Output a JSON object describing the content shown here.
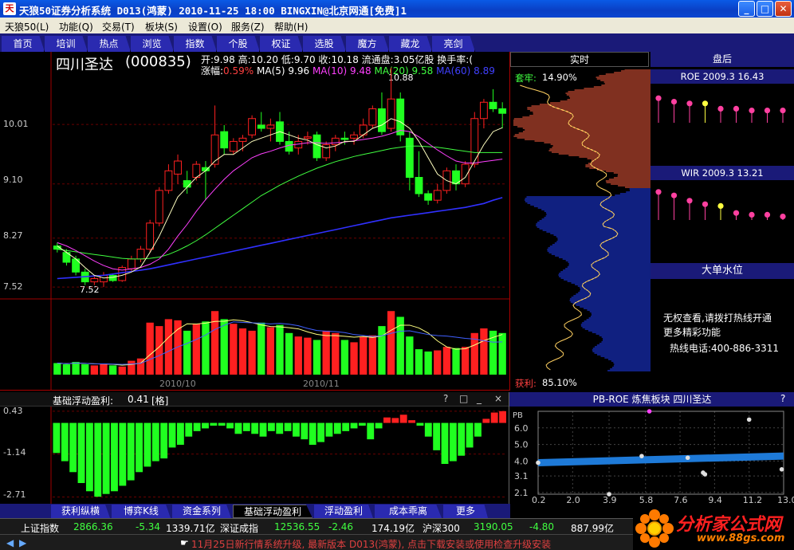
{
  "window": {
    "title": "天狼50证券分析系统 D013(鸿蒙) 2010-11-25 18:00 BINGXIN@北京网通[免费]1",
    "icon": "tianlang-logo-icon"
  },
  "menu": [
    {
      "label": "天狼50(L)"
    },
    {
      "label": "功能(Q)"
    },
    {
      "label": "交易(T)"
    },
    {
      "label": "板块(S)"
    },
    {
      "label": "设置(O)"
    },
    {
      "label": "服务(Z)"
    },
    {
      "label": "帮助(H)"
    }
  ],
  "toolbar": [
    "首页",
    "培训",
    "热点",
    "浏览",
    "指数",
    "个股",
    "权证",
    "选股",
    "魔方",
    "藏龙",
    "亮剑"
  ],
  "stock": {
    "name": "四川圣达",
    "code": "(000835)",
    "open_label": "开:",
    "open": "9.98",
    "high_label": "高:",
    "high": "10.20",
    "low_label": "低:",
    "low": "9.70",
    "close_label": "收:",
    "close": "10.18",
    "float_label": "流通盘:",
    "float": "3.05亿股",
    "turnover_label": "换手率:",
    "turnover": "(",
    "change_label": "涨幅:",
    "change": "0.59%"
  },
  "ma": [
    {
      "label": "MA(5)",
      "value": "9.96",
      "color": "#ffffff"
    },
    {
      "label": "MA(10)",
      "value": "9.48",
      "color": "#ff40ff"
    },
    {
      "label": "MA(20)",
      "value": "9.58",
      "color": "#40ff40"
    },
    {
      "label": "MA(60)",
      "value": "8.89",
      "color": "#4040ff"
    }
  ],
  "price_axis": [
    "10.01",
    "9.10",
    "8.27",
    "7.52"
  ],
  "markers": {
    "high": "10.88",
    "low": "7.52"
  },
  "months": [
    "2010/10",
    "2010/11"
  ],
  "chart_data": [
    {
      "type": "candlestick",
      "title": "四川圣达(000835)",
      "candles": [
        [
          8.15,
          8.2,
          8.05,
          8.1
        ],
        [
          8.05,
          8.1,
          7.85,
          7.9
        ],
        [
          7.95,
          8.0,
          7.7,
          7.75
        ],
        [
          7.75,
          7.8,
          7.55,
          7.6
        ],
        [
          7.6,
          7.7,
          7.55,
          7.65
        ],
        [
          7.6,
          7.75,
          7.52,
          7.7
        ],
        [
          7.7,
          7.72,
          7.6,
          7.62
        ],
        [
          7.62,
          7.85,
          7.6,
          7.82
        ],
        [
          7.8,
          8.0,
          7.75,
          7.95
        ],
        [
          7.95,
          8.15,
          7.9,
          8.1
        ],
        [
          8.1,
          8.55,
          8.05,
          8.5
        ],
        [
          8.5,
          9.05,
          8.45,
          9.0
        ],
        [
          9.0,
          9.4,
          8.95,
          9.3
        ],
        [
          9.25,
          9.55,
          9.1,
          9.45
        ],
        [
          9.15,
          9.3,
          8.95,
          9.05
        ],
        [
          9.2,
          9.45,
          9.15,
          9.4
        ],
        [
          9.35,
          9.45,
          8.85,
          9.3
        ],
        [
          9.4,
          10.3,
          9.35,
          9.85
        ],
        [
          9.9,
          10.0,
          9.55,
          9.65
        ],
        [
          9.6,
          9.8,
          9.55,
          9.75
        ],
        [
          9.75,
          9.85,
          9.6,
          9.8
        ],
        [
          9.85,
          10.15,
          9.8,
          10.1
        ],
        [
          10.0,
          10.2,
          9.9,
          9.95
        ],
        [
          9.95,
          10.1,
          9.75,
          10.0
        ],
        [
          10.05,
          10.2,
          9.7,
          9.75
        ],
        [
          9.75,
          9.9,
          9.55,
          9.6
        ],
        [
          9.65,
          9.85,
          9.55,
          9.75
        ],
        [
          9.8,
          9.9,
          9.7,
          9.82
        ],
        [
          9.85,
          9.9,
          9.45,
          9.5
        ],
        [
          9.5,
          9.75,
          9.45,
          9.7
        ],
        [
          9.7,
          9.85,
          9.6,
          9.8
        ],
        [
          9.8,
          9.9,
          9.7,
          9.78
        ],
        [
          9.8,
          9.9,
          9.7,
          9.85
        ],
        [
          9.85,
          10.1,
          9.8,
          10.0
        ],
        [
          10.0,
          10.3,
          9.95,
          10.25
        ],
        [
          10.25,
          10.5,
          9.85,
          9.9
        ],
        [
          9.95,
          10.88,
          9.9,
          10.4
        ],
        [
          10.4,
          10.5,
          9.75,
          9.85
        ],
        [
          9.8,
          9.9,
          9.0,
          9.2
        ],
        [
          9.2,
          9.6,
          8.9,
          8.95
        ],
        [
          8.95,
          9.0,
          8.78,
          8.85
        ],
        [
          8.85,
          9.1,
          8.8,
          9.0
        ],
        [
          9.0,
          9.35,
          8.95,
          9.3
        ],
        [
          9.3,
          9.4,
          9.0,
          9.1
        ],
        [
          9.1,
          9.45,
          9.05,
          9.4
        ],
        [
          9.4,
          10.2,
          9.35,
          10.1
        ],
        [
          10.1,
          10.4,
          9.95,
          10.35
        ],
        [
          10.35,
          10.55,
          10.2,
          10.25
        ],
        [
          10.25,
          10.35,
          9.95,
          10.18
        ]
      ],
      "ylim": [
        7.4,
        11.0
      ],
      "ma5": [
        8.15,
        8.05,
        7.95,
        7.82,
        7.7,
        7.66,
        7.67,
        7.7,
        7.75,
        7.83,
        8.05,
        8.3,
        8.6,
        8.9,
        9.05,
        9.2,
        9.3,
        9.45,
        9.55,
        9.55,
        9.65,
        9.75,
        9.8,
        9.85,
        9.9,
        9.85,
        9.8,
        9.77,
        9.7,
        9.65,
        9.68,
        9.75,
        9.75,
        9.85,
        9.95,
        10.0,
        10.1,
        10.05,
        9.95,
        9.75,
        9.5,
        9.25,
        9.15,
        9.1,
        9.2,
        9.45,
        9.7,
        9.9,
        9.96
      ],
      "ma10": [
        8.2,
        8.15,
        8.08,
        8.0,
        7.92,
        7.85,
        7.8,
        7.78,
        7.8,
        7.82,
        7.87,
        7.95,
        8.1,
        8.3,
        8.48,
        8.68,
        8.86,
        9.02,
        9.17,
        9.3,
        9.4,
        9.5,
        9.56,
        9.6,
        9.65,
        9.69,
        9.71,
        9.73,
        9.73,
        9.72,
        9.73,
        9.74,
        9.76,
        9.78,
        9.8,
        9.83,
        9.87,
        9.92,
        9.9,
        9.82,
        9.72,
        9.62,
        9.53,
        9.45,
        9.42,
        9.42,
        9.44,
        9.46,
        9.48
      ],
      "ma20": [
        8.1,
        8.08,
        8.06,
        8.04,
        8.02,
        8.0,
        7.98,
        7.96,
        7.95,
        7.95,
        7.96,
        7.98,
        8.02,
        8.08,
        8.15,
        8.23,
        8.32,
        8.42,
        8.52,
        8.62,
        8.72,
        8.82,
        8.92,
        9.0,
        9.08,
        9.15,
        9.22,
        9.28,
        9.34,
        9.39,
        9.44,
        9.48,
        9.52,
        9.55,
        9.58,
        9.61,
        9.64,
        9.66,
        9.68,
        9.68,
        9.67,
        9.66,
        9.64,
        9.62,
        9.6,
        9.58,
        9.58,
        9.58,
        9.58
      ],
      "ma60": [
        7.65,
        7.66,
        7.67,
        7.68,
        7.69,
        7.7,
        7.72,
        7.74,
        7.76,
        7.78,
        7.8,
        7.83,
        7.86,
        7.89,
        7.92,
        7.95,
        7.98,
        8.01,
        8.04,
        8.07,
        8.1,
        8.13,
        8.16,
        8.19,
        8.22,
        8.25,
        8.28,
        8.31,
        8.34,
        8.37,
        8.4,
        8.43,
        8.46,
        8.49,
        8.52,
        8.55,
        8.58,
        8.6,
        8.62,
        8.64,
        8.66,
        8.68,
        8.7,
        8.72,
        8.74,
        8.77,
        8.8,
        8.85,
        8.89
      ]
    },
    {
      "type": "bar",
      "title": "volume",
      "values": [
        10,
        9,
        11,
        9,
        8,
        9,
        8,
        7,
        12,
        14,
        45,
        42,
        48,
        47,
        38,
        44,
        46,
        55,
        48,
        44,
        40,
        38,
        45,
        41,
        43,
        36,
        33,
        32,
        30,
        38,
        36,
        30,
        28,
        33,
        34,
        42,
        55,
        50,
        33,
        22,
        20,
        21,
        24,
        23,
        24,
        36,
        40,
        38,
        36
      ]
    },
    {
      "type": "bar",
      "title": "基础浮动盈利",
      "values": [
        -1.1,
        -1.4,
        -1.8,
        -2.2,
        -2.5,
        -2.7,
        -2.6,
        -2.5,
        -2.3,
        -2.1,
        -1.8,
        -1.6,
        -1.4,
        -1.3,
        -0.9,
        -0.8,
        -0.5,
        -0.3,
        -0.2,
        -0.1,
        -0.1,
        -0.2,
        -0.4,
        -0.3,
        -0.4,
        -0.5,
        -0.3,
        -0.4,
        -0.3,
        -0.5,
        -0.6,
        -0.8,
        -0.7,
        -0.5,
        -0.4,
        -0.3,
        -0.2,
        -0.1,
        -0.6,
        -0.2,
        0.2,
        0.18,
        0.3,
        0.1,
        -0.1,
        -0.5,
        -1.0,
        -1.5,
        -1.4,
        -1.2,
        -0.9,
        -0.5,
        0.15,
        0.38,
        0.43
      ],
      "ylim": [
        -2.9,
        0.6
      ]
    },
    {
      "type": "scatter",
      "title": "PB-ROE 炼焦板块 四川圣达",
      "xlabel": "",
      "ylabel": "PB",
      "x_ticks": [
        "0.2",
        "2.0",
        "3.9",
        "5.8",
        "7.6",
        "9.4",
        "11.2",
        "13.0"
      ],
      "y_ticks": [
        "6.0",
        "5.0",
        "4.0",
        "3.1",
        "2.1"
      ],
      "points": [
        [
          0.2,
          3.9
        ],
        [
          5.6,
          4.3
        ],
        [
          8.0,
          4.2
        ],
        [
          8.8,
          3.3
        ],
        [
          8.9,
          3.2
        ],
        [
          11.2,
          6.5
        ],
        [
          3.9,
          2.0
        ],
        [
          12.9,
          3.5
        ],
        [
          6.0,
          7.0
        ]
      ],
      "trend": [
        [
          0.2,
          3.9
        ],
        [
          13.0,
          4.3
        ]
      ],
      "xlim": [
        0.2,
        13.0
      ],
      "ylim": [
        2.0,
        7.0
      ]
    }
  ],
  "right": {
    "tabs": [
      "实时",
      "盘后"
    ],
    "taochao_label": "套牢:",
    "taochao_value": "14.90%",
    "profit_label": "获利:",
    "profit_value": "85.10%",
    "roe_title": "ROE 2009.3 16.43",
    "wir_title": "WIR 2009.3 13.21",
    "bigorder_title": "大单水位",
    "notice": [
      "无权查看,请拨打热线开通",
      "更多精彩功能",
      "热线电话:400-886-3311"
    ],
    "roe_values": [
      0.7,
      0.6,
      0.55,
      0.55,
      0.4,
      0.4,
      0.35,
      0.35,
      0.35
    ],
    "roe_colors": [
      "#ff40a0",
      "#ff40a0",
      "#ff40a0",
      "#ffff40",
      "#ff40a0",
      "#ff40a0",
      "#ff40a0",
      "#ff40a0",
      "#ff40a0"
    ],
    "wir_values": [
      0.8,
      0.7,
      0.55,
      0.45,
      0.4,
      0.2,
      0.15,
      0.15,
      0.1
    ],
    "wir_colors": [
      "#ff40a0",
      "#ff40a0",
      "#ff40a0",
      "#ff40a0",
      "#ffff40",
      "#ff40a0",
      "#ff40a0",
      "#ff40a0",
      "#ff40a0"
    ]
  },
  "indicator": {
    "name": "基础浮动盈利:",
    "value": "0.41",
    "unit": "[格]",
    "axis": [
      "0.43",
      "-1.14",
      "-2.71"
    ],
    "ctrl": [
      "?",
      "□",
      "_",
      "×"
    ]
  },
  "pbroe": {
    "title": "PB-ROE 炼焦板块 四川圣达",
    "help": "?"
  },
  "bottom_tabs": [
    "获利纵横",
    "博弈K线",
    "资金系列",
    "基础浮动盈利",
    "浮动盈利",
    "成本乖离",
    "更多"
  ],
  "index": [
    {
      "name": "上证指数",
      "value": "2866.36",
      "change": "-5.34",
      "vol": "1339.71亿"
    },
    {
      "name": "深证成指",
      "value": "12536.55",
      "change": "-2.46",
      "vol": "174.19亿"
    },
    {
      "name": "沪深300",
      "value": "3190.05",
      "change": "-4.80",
      "vol": "887.99亿"
    }
  ],
  "status": "11月25日新行情系统升级, 最新版本 D013(鸿蒙), 点击下载安装或使用检查升级安装",
  "brand": {
    "name": "分析家公式网",
    "url": "www.88gs.com"
  }
}
